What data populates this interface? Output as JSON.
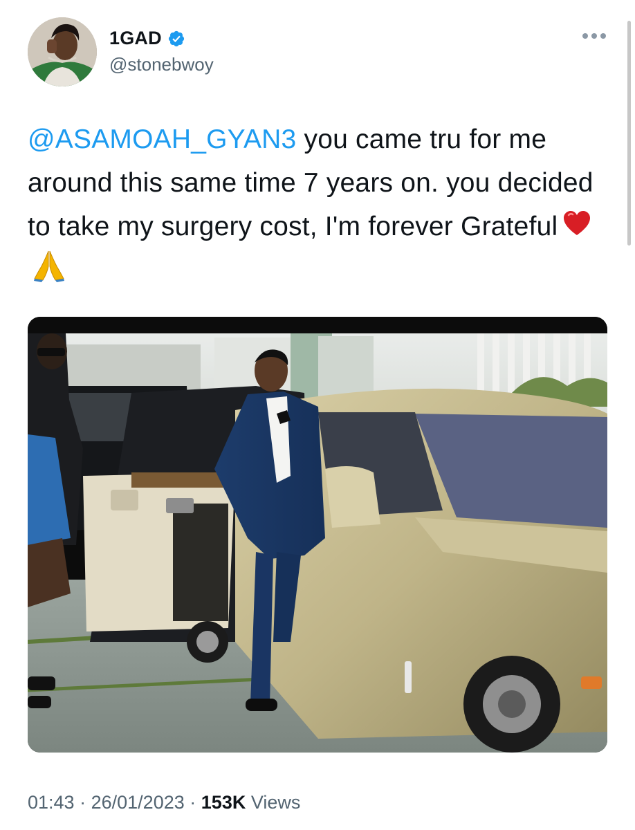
{
  "author": {
    "display_name": "1GAD",
    "handle": "@stonebwoy",
    "verified_icon": "verified-badge-icon",
    "avatar_icon": "user-avatar"
  },
  "tweet": {
    "mention": "@ASAMOAH_GYAN3",
    "text": " you came tru for me around this same time 7 years on. you decided to take my surgery cost, I'm forever Grateful",
    "emojis": [
      "red-heart",
      "folded-hands"
    ]
  },
  "meta": {
    "time": "01:43",
    "separator": "·",
    "date": "26/01/2023",
    "views_count": "153K",
    "views_label": "Views"
  },
  "colors": {
    "accent": "#1d9bf0",
    "text": "#0f1419",
    "secondary": "#536471"
  }
}
